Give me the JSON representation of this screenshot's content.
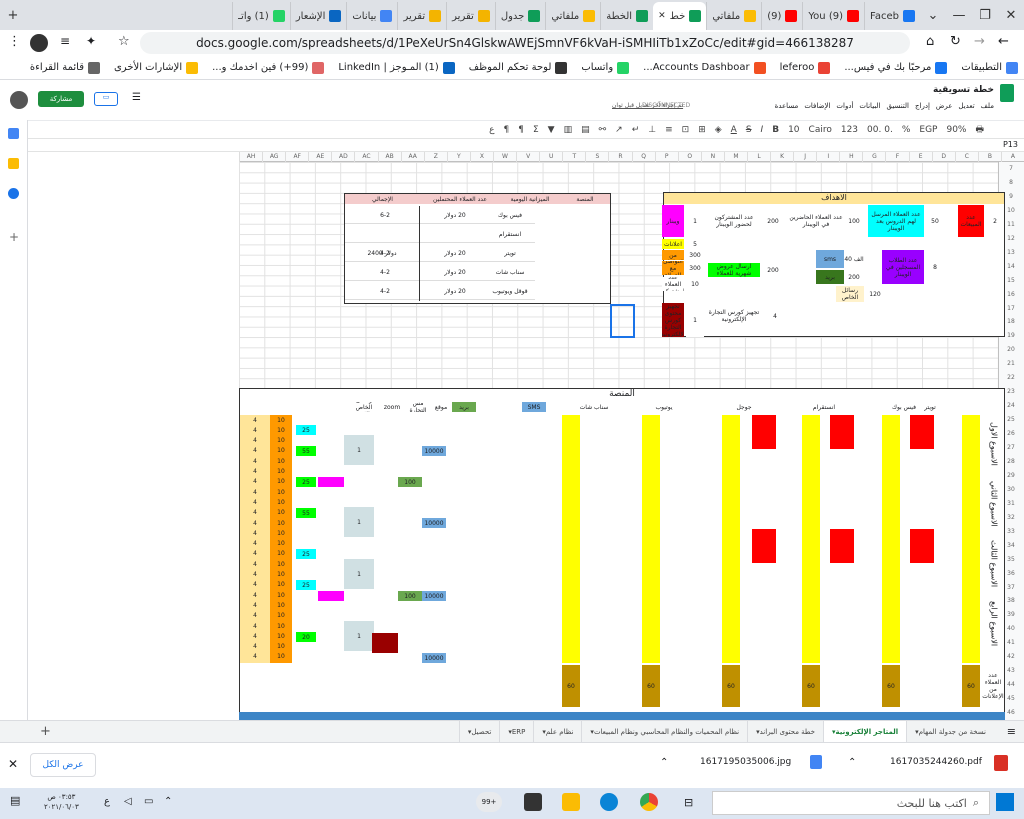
{
  "browser": {
    "tabs": [
      {
        "label": "Faceb",
        "color": "#1877f2"
      },
      {
        "label": "(9) You",
        "color": "#ff0000"
      },
      {
        "label": "(9)",
        "color": "#ff0000"
      },
      {
        "label": "ملفاتي",
        "color": "#fbbc04"
      },
      {
        "label": "خط",
        "color": "#0f9d58",
        "active": true
      },
      {
        "label": "الخطة",
        "color": "#0f9d58"
      },
      {
        "label": "ملفاتي",
        "color": "#fbbc04"
      },
      {
        "label": "جدول",
        "color": "#0f9d58"
      },
      {
        "label": "تقرير",
        "color": "#f4b400"
      },
      {
        "label": "تقرير",
        "color": "#f4b400"
      },
      {
        "label": "بيانات",
        "color": "#4285f4"
      },
      {
        "label": "الإشعار",
        "color": "#0a66c2"
      },
      {
        "label": "(1) واتـ",
        "color": "#25d366"
      }
    ],
    "url": "docs.google.com/spreadsheets/d/1PeXeUrSn4GlskwAWEjSmnVF6kVaH-iSMHIiTb1xZoCc/edit#gid=466138287",
    "bookmarks": [
      {
        "label": "التطبيقات",
        "icon": "apps-icon"
      },
      {
        "label": "مرحبًا بك في فيس...",
        "color": "#1877f2"
      },
      {
        "label": "leferoo",
        "color": "#ea4335"
      },
      {
        "label": "Accounts Dashboar...",
        "color": "#f25022"
      },
      {
        "label": "واتساب",
        "color": "#25d366"
      },
      {
        "label": "لوحة تحكم الموظف",
        "color": "#333"
      },
      {
        "label": "(1) المـوجز | LinkedIn",
        "color": "#0a66c2"
      },
      {
        "label": "(99+) فين اخدمك و...",
        "color": "#e06666"
      },
      {
        "label": "الإشارات الأخرى",
        "color": "#fbbc04"
      },
      {
        "label": "قائمة القراءة",
        "color": "#666"
      }
    ]
  },
  "doc": {
    "title": "خطة تسويقية",
    "menus": [
      "ملف",
      "تعديل",
      "عرض",
      "إدراج",
      "التنسيق",
      "البيانات",
      "أدوات",
      "الإضافات",
      "مساعدة"
    ],
    "status": "DISCONNECTED",
    "last_edit": "تم إجراء آخر تعديل قبل ثوان",
    "share_label": "مشاركة"
  },
  "toolbar": {
    "zoom": "90%",
    "currency": "EGP",
    "percent": "%",
    "decimals": ".0  .00",
    "format": "123",
    "font": "Cairo",
    "size": "10"
  },
  "formula": {
    "cell": "P13"
  },
  "columns": [
    "A",
    "B",
    "C",
    "D",
    "E",
    "F",
    "G",
    "H",
    "I",
    "J",
    "K",
    "L",
    "M",
    "N",
    "O",
    "P",
    "Q",
    "R",
    "S",
    "T",
    "U",
    "V",
    "W",
    "X",
    "Y",
    "Z",
    "AA",
    "AB",
    "AC",
    "AD",
    "AE",
    "AF",
    "AG",
    "AH"
  ],
  "rows": [
    "7",
    "8",
    "9",
    "10",
    "11",
    "12",
    "13",
    "14",
    "15",
    "16",
    "17",
    "18",
    "19",
    "20",
    "21",
    "22",
    "23",
    "24",
    "25",
    "26",
    "27",
    "28",
    "29",
    "30",
    "31",
    "32",
    "33",
    "34",
    "35",
    "36",
    "37",
    "38",
    "39",
    "40",
    "41",
    "42",
    "43",
    "44",
    "45",
    "46"
  ],
  "goals": {
    "title": "الاهداف",
    "cells": [
      {
        "text": "ويبنار",
        "color": "#ff00ff"
      },
      {
        "text": "1",
        "color": "#fff"
      },
      {
        "text": "عدد المشتركون لحضور الويبنار",
        "color": "#fff"
      },
      {
        "text": "200",
        "color": "#fff"
      },
      {
        "text": "عدد العملاء الحاضرين في الويبنار",
        "color": "#fff"
      },
      {
        "text": "100",
        "color": "#fff"
      },
      {
        "text": "عدد العملاء المرسل لهم الدروس بعد الويبنار",
        "color": "#00ffff"
      },
      {
        "text": "50",
        "color": "#fff"
      },
      {
        "text": "عدد المبيعات",
        "color": "#ff0000"
      },
      {
        "text": "2",
        "color": "#fff"
      },
      {
        "text": "اعلانات",
        "color": "#ffff00"
      },
      {
        "text": "5",
        "color": "#fff"
      },
      {
        "text": "عملاء من الإعلانات",
        "color": "#ff9900"
      },
      {
        "text": "300",
        "color": "#fff"
      },
      {
        "text": "sms",
        "color": "#6fa8dc"
      },
      {
        "text": "40 الف",
        "color": "#fff"
      },
      {
        "text": "التواصل مع العملاء",
        "color": "#ff9900"
      },
      {
        "text": "300",
        "color": "#fff"
      },
      {
        "text": "ارسال عروض شهرية للعملاء",
        "color": "#00ff00"
      },
      {
        "text": "200",
        "color": "#fff"
      },
      {
        "text": "بريد",
        "color": "#38761d"
      },
      {
        "text": "200",
        "color": "#fff"
      },
      {
        "text": "عدد الطلاب المسجلين في الويبنار",
        "color": "#9900ff"
      },
      {
        "text": "8",
        "color": "#fff"
      },
      {
        "text": "عدد العملاء المشتركين",
        "color": "#fff"
      },
      {
        "text": "10",
        "color": "#fff"
      },
      {
        "text": "رسائل الخاص",
        "color": "#fff2cc"
      },
      {
        "text": "120",
        "color": "#fff"
      },
      {
        "text": "تجهيز كورس التجارة الإلكترونية",
        "color": "#fff"
      },
      {
        "text": "4",
        "color": "#fff"
      },
      {
        "text": "تجهيز محتوى كورس التجارة الإلكترونية",
        "color": "#990000"
      },
      {
        "text": "1",
        "color": "#fff"
      }
    ]
  },
  "budget": {
    "headers": [
      "المنصة",
      "الميزانية اليومية",
      "عدد العملاء المحتملين",
      "الإجمالي"
    ],
    "rows": [
      [
        "فيس بوك",
        "20 دولار",
        "6-2"
      ],
      [
        "انستقرام",
        "",
        ""
      ],
      [
        "تويتر",
        "20 دولار",
        "4-2"
      ],
      [
        "سناب شات",
        "20 دولار",
        "4-2"
      ],
      [
        "قوقل ويوتيوب",
        "20 دولار",
        "4-2"
      ]
    ],
    "total": "2400 دولار"
  },
  "platform": {
    "title": "المنصة",
    "headers": [
      "تويتر",
      "فيس بوك",
      "انستقرام",
      "جوجل",
      "يوتيوب",
      "سناب شات",
      "SMS",
      "بريد",
      "موقع",
      "مس التجارة",
      "zoom",
      "رسائل الخاص والاتس"
    ],
    "weeks": [
      "الاسبوع الاول",
      "الاسبوع الثاني",
      "الاسبوع الثالث",
      "الاسبوع الرابع"
    ],
    "footer_label": "عدد العملاء من الإعلانات",
    "footer_values": [
      "60",
      "60",
      "60",
      "60",
      "60",
      "60"
    ],
    "col_values": {
      "ten": "10",
      "four": "4",
      "one": "1",
      "sms": "10000",
      "mail": "100",
      "zoom1": "25",
      "zoom2": "55",
      "zoom3": "20"
    }
  },
  "sheet_tabs": [
    "نسخة من جدولة المهام",
    "المتاجر الإلكترونية",
    "خطة محتوى البراند",
    "نظام المحميات والنظام المحاسبي ونظام المبيعات",
    "نظام علم",
    "ERP",
    "تحصيل"
  ],
  "downloads": {
    "items": [
      "1617035244260.pdf",
      "1617195035006.jpg"
    ],
    "show_all": "عرض الكل"
  },
  "taskbar": {
    "search": "اكتب هنا للبحث",
    "time": "٠٣:٥٣ ص",
    "date": "٢٠٢١/٠٦/٠٣",
    "lang": "ع",
    "badge": "99+"
  }
}
